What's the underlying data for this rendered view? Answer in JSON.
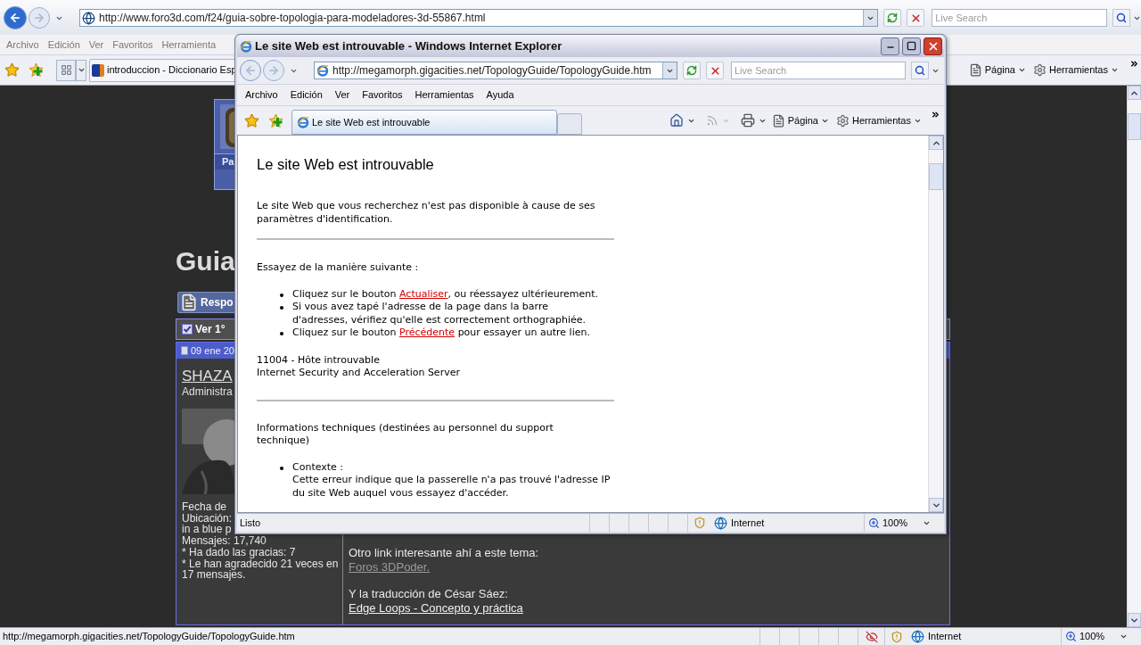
{
  "browser": {
    "address": "http://www.foro3d.com/f24/guia-sobre-topologia-para-modeladores-3d-55867.html",
    "search_placeholder": "Live Search",
    "menu": [
      "Archivo",
      "Edición",
      "Ver",
      "Favoritos",
      "Herramienta"
    ],
    "tab": "introduccion - Diccionario Esp",
    "toolbar": [
      "Página",
      "Herramientas"
    ],
    "forum": {
      "header_label": "Pa",
      "title": "Guia",
      "reply_button": "Respo",
      "view_first": "Ver 1°",
      "post": {
        "date": "09 ene 20",
        "author": "SHAZA",
        "role": "Administra",
        "details": [
          "Fecha de",
          "Ubicación:",
          "in a blue p",
          "Mensajes: 17,740",
          "* Ha dado las gracias: 7",
          "* Le han agradecido 21 veces en 17 mensajes."
        ],
        "body": [
          {
            "text": "Otro link interesante ahí a este tema:",
            "link": "Foros 3DPoder.",
            "visited": true
          },
          {
            "text": "Y la traducción de César Sáez:",
            "link": "Edge Loops -  Concepto y práctica",
            "visited": false
          }
        ]
      }
    },
    "status_bar": {
      "text": "http://megamorph.gigacities.net/TopologyGuide/TopologyGuide.htm",
      "zone": "Internet",
      "zoom": "100%"
    }
  },
  "popup": {
    "title": "Le site Web est introuvable - Windows Internet Explorer",
    "address": "http://megamorph.gigacities.net/TopologyGuide/TopologyGuide.htm",
    "search_placeholder": "Live Search",
    "menu": [
      "Archivo",
      "Edición",
      "Ver",
      "Favoritos",
      "Herramientas",
      "Ayuda"
    ],
    "tab": "Le site Web est introuvable",
    "toolbar": [
      "Página",
      "Herramientas"
    ],
    "page": {
      "heading": "Le site Web est introuvable",
      "intro": "Le site Web que vous recherchez n'est pas disponible à cause de ses paramètres d'identification.",
      "suggest_title": "Essayez de la manière suivante :",
      "suggestions": [
        {
          "before": "Cliquez sur le bouton ",
          "link": "Actualiser",
          "after": ", ou réessayez ultérieurement."
        },
        {
          "before": "Si vous avez tapé l'adresse de la page dans la barre d'adresses, vérifiez qu'elle est correctement orthographiée."
        },
        {
          "before": "Cliquez sur le bouton ",
          "link": "Précédente",
          "after": " pour essayer un autre lien."
        }
      ],
      "error_code": "11004 - Hôte introuvable",
      "server": "Internet Security and Acceleration Server",
      "tech_title": "Informations techniques (destinées au personnel du support technique)",
      "tech_items": [
        {
          "label": "Contexte :",
          "text": "Cette erreur indique que la passerelle n'a pas trouvé l'adresse IP du site Web auquel vous essayez d'accéder."
        }
      ]
    },
    "status_bar": {
      "text": "Listo",
      "zone": "Internet",
      "zoom": "100%"
    }
  }
}
